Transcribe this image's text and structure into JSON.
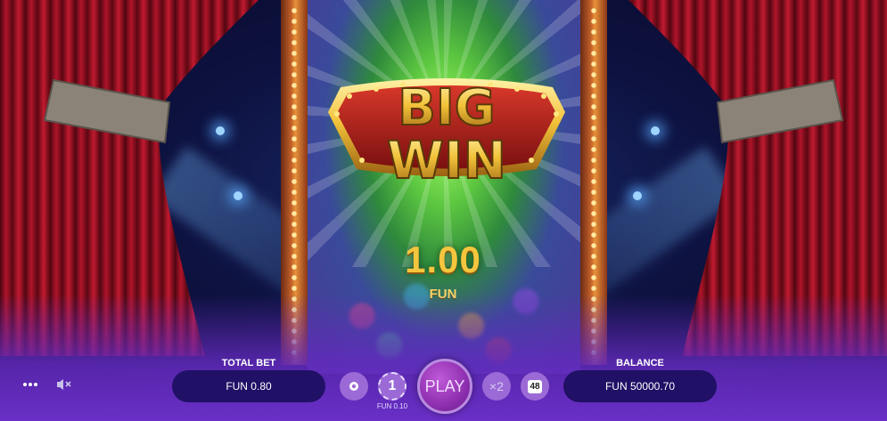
{
  "banner": {
    "line1": "BIG",
    "line2": "WIN"
  },
  "win": {
    "amount": "1.00",
    "currency": "FUN"
  },
  "controls": {
    "total_bet_label": "TOTAL BET",
    "total_bet_value": "FUN 0.80",
    "coin_value": "1",
    "coin_sub": "FUN 0.10",
    "play_label": "PLAY",
    "multiplier_label": "×2",
    "autoplay_count": "48",
    "balance_label": "BALANCE",
    "balance_value": "FUN 50000.70"
  },
  "icons": {
    "menu": "more-dots-icon",
    "sound": "speaker-muted-icon",
    "bet_chip": "chip-icon"
  },
  "colors": {
    "gold": "#f4c63e",
    "banner_red": "#b8261e",
    "pill_bg": "#201066",
    "button_bg": "#9b6ad6",
    "play_bg": "#8e2fb0",
    "bottom_purple": "#6a2fc7"
  }
}
